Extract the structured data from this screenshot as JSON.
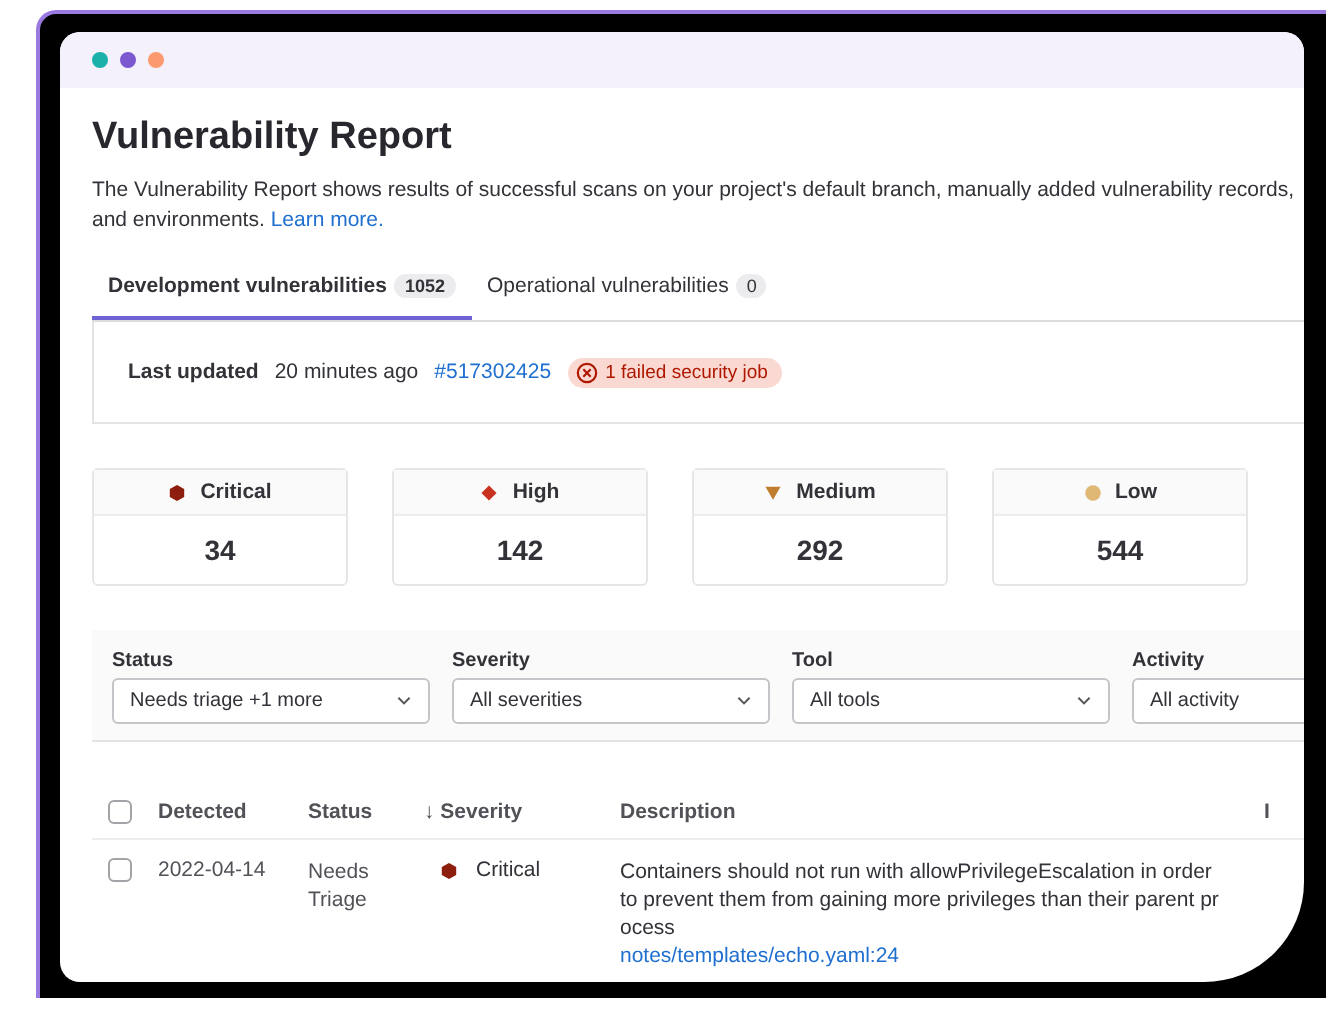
{
  "window": {
    "title": "Vulnerability Report"
  },
  "intro": {
    "text": "The Vulnerability Report shows results of successful scans on your project's default branch, manually added vulnerability records, and environments.",
    "link": "Learn more."
  },
  "tabs": [
    {
      "label": "Development vulnerabilities",
      "count": "1052",
      "selected": true
    },
    {
      "label": "Operational vulnerabilities",
      "count": "0",
      "selected": false
    }
  ],
  "status": {
    "label": "Last updated",
    "time": "20 minutes ago",
    "pipeline": "#517302425",
    "alert": "1 failed security job"
  },
  "severity_cards": [
    {
      "kind": "critical",
      "label": "Critical",
      "count": "34"
    },
    {
      "kind": "high",
      "label": "High",
      "count": "142"
    },
    {
      "kind": "medium",
      "label": "Medium",
      "count": "292"
    },
    {
      "kind": "low",
      "label": "Low",
      "count": "544"
    }
  ],
  "filters": [
    {
      "label": "Status",
      "value": "Needs triage +1 more"
    },
    {
      "label": "Severity",
      "value": "All severities"
    },
    {
      "label": "Tool",
      "value": "All tools"
    },
    {
      "label": "Activity",
      "value": "All activity"
    }
  ],
  "table": {
    "select_all": {
      "checked": false
    },
    "columns": [
      "Detected",
      "Status",
      "↓ Severity",
      "Description",
      "I"
    ],
    "rows": [
      {
        "checked": false,
        "detected": "2022-04-14",
        "status": "Needs Triage",
        "severity": {
          "kind": "critical",
          "label": "Critical"
        },
        "description": "Containers should not run with allowPrivilegeEscalation in order to prevent them from gaining more privileges than their parent process",
        "file": "notes/templates/echo.yaml:24"
      }
    ]
  }
}
